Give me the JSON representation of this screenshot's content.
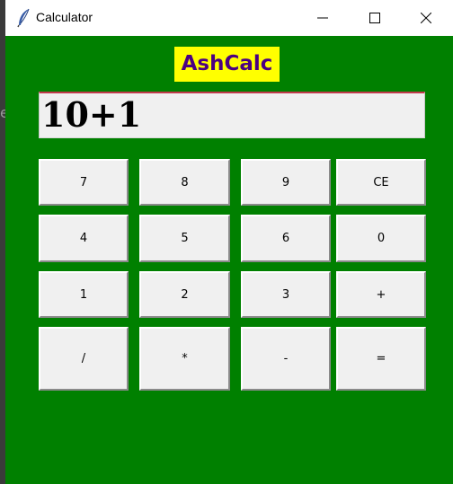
{
  "window": {
    "title": "Calculator",
    "controls": [
      "minimize",
      "maximize",
      "close"
    ]
  },
  "app": {
    "heading": "AshCalc"
  },
  "display": {
    "value": "10+1"
  },
  "keypad": {
    "rows": [
      [
        "7",
        "8",
        "9",
        "CE"
      ],
      [
        "4",
        "5",
        "6",
        "0"
      ],
      [
        "1",
        "2",
        "3",
        "+"
      ],
      [
        "/",
        "*",
        "-",
        "="
      ]
    ]
  },
  "colors": {
    "background": "#008000",
    "heading_bg": "#ffff00",
    "heading_text": "#4b0082",
    "button_face": "#f0f0f0"
  }
}
